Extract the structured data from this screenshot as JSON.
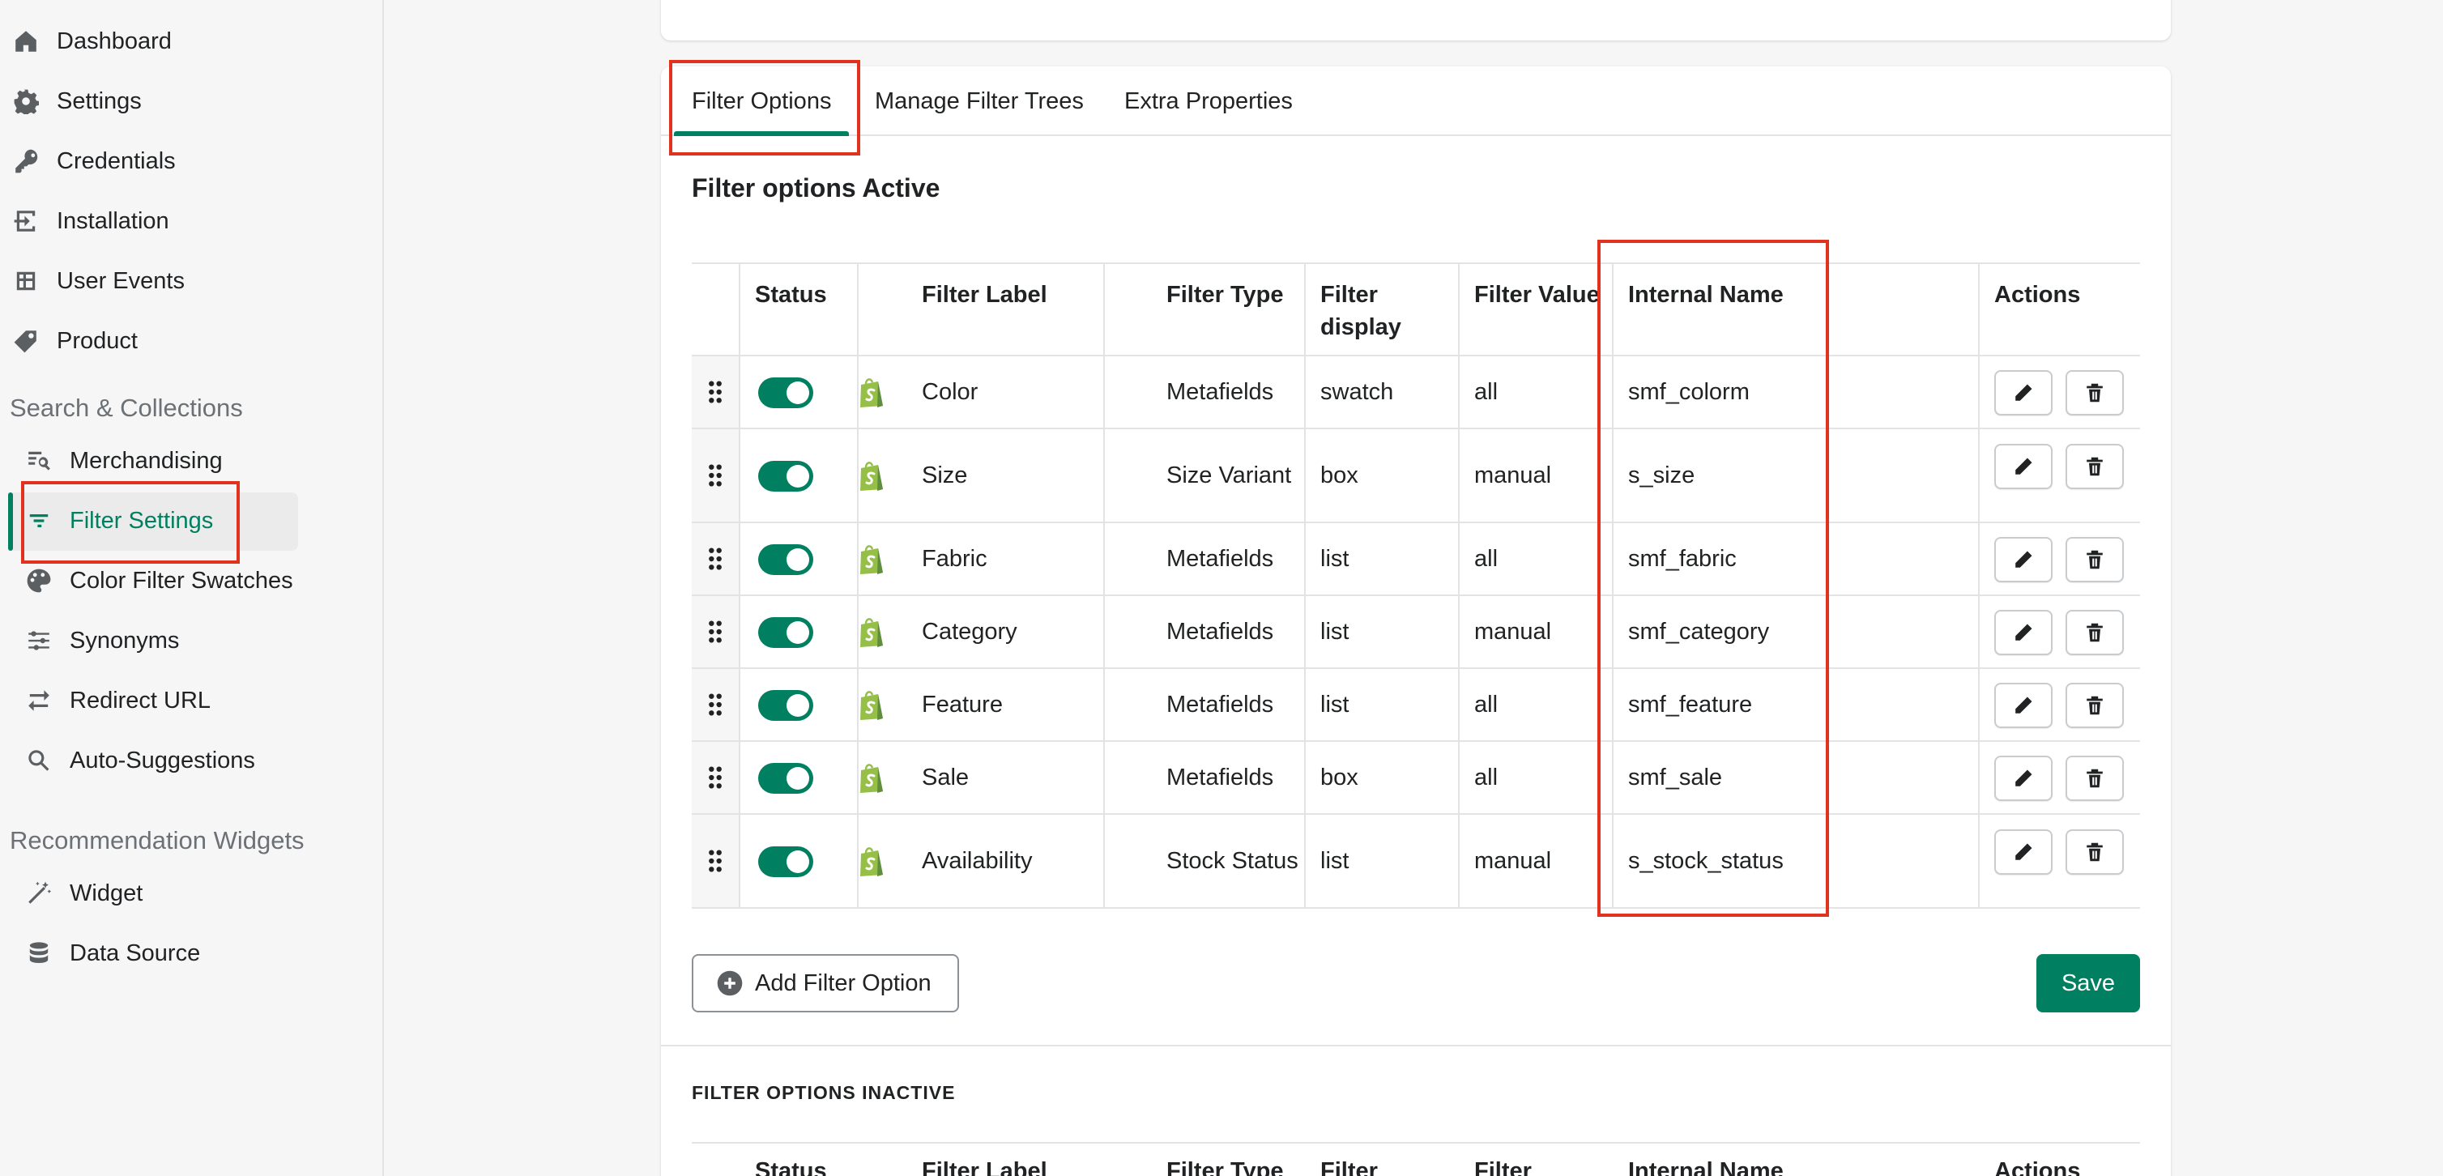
{
  "sidebar": {
    "items": [
      {
        "label": "Dashboard",
        "icon": "home-icon"
      },
      {
        "label": "Settings",
        "icon": "gear-icon"
      },
      {
        "label": "Credentials",
        "icon": "key-icon"
      },
      {
        "label": "Installation",
        "icon": "install-icon"
      },
      {
        "label": "User Events",
        "icon": "table-icon"
      },
      {
        "label": "Product",
        "icon": "tag-icon"
      }
    ],
    "section_search": "Search & Collections",
    "search_items": [
      {
        "label": "Merchandising",
        "icon": "search-list-icon"
      },
      {
        "label": "Filter Settings",
        "icon": "filter-icon"
      },
      {
        "label": "Color Filter Swatches",
        "icon": "palette-icon"
      },
      {
        "label": "Synonyms",
        "icon": "sliders-icon"
      },
      {
        "label": "Redirect URL",
        "icon": "redirect-icon"
      },
      {
        "label": "Auto-Suggestions",
        "icon": "magnifier-icon"
      }
    ],
    "section_widgets": "Recommendation Widgets",
    "widget_items": [
      {
        "label": "Widget",
        "icon": "magic-wand-icon"
      },
      {
        "label": "Data Source",
        "icon": "database-icon"
      }
    ]
  },
  "tabs": [
    "Filter Options",
    "Manage Filter Trees",
    "Extra Properties"
  ],
  "active_title": "Filter options Active",
  "columns": [
    "Status",
    "Filter Label",
    "Filter Type",
    "Filter display",
    "Filter Value",
    "Internal Name",
    "Actions"
  ],
  "rows": [
    {
      "label": "Color",
      "type": "Metafields",
      "display": "swatch",
      "value": "all",
      "internal": "smf_colorm",
      "enabled": true
    },
    {
      "label": "Size",
      "type": "Size Variant",
      "display": "box",
      "value": "manual",
      "internal": "s_size",
      "enabled": true
    },
    {
      "label": "Fabric",
      "type": "Metafields",
      "display": "list",
      "value": "all",
      "internal": "smf_fabric",
      "enabled": true
    },
    {
      "label": "Category",
      "type": "Metafields",
      "display": "list",
      "value": "manual",
      "internal": "smf_category",
      "enabled": true
    },
    {
      "label": "Feature",
      "type": "Metafields",
      "display": "list",
      "value": "all",
      "internal": "smf_feature",
      "enabled": true
    },
    {
      "label": "Sale",
      "type": "Metafields",
      "display": "box",
      "value": "all",
      "internal": "smf_sale",
      "enabled": true
    },
    {
      "label": "Availability",
      "type": "Stock Status",
      "display": "list",
      "value": "manual",
      "internal": "s_stock_status",
      "enabled": true
    }
  ],
  "add_button": "Add Filter Option",
  "save_button": "Save",
  "inactive_title": "FILTER OPTIONS INACTIVE",
  "inactive_columns": [
    "Status",
    "Filter Label",
    "Filter Type",
    "Filter",
    "Filter",
    "Internal Name",
    "Actions"
  ],
  "colors": {
    "accent": "#008060",
    "highlight": "#e0321f",
    "shopify": "#95bf47"
  }
}
